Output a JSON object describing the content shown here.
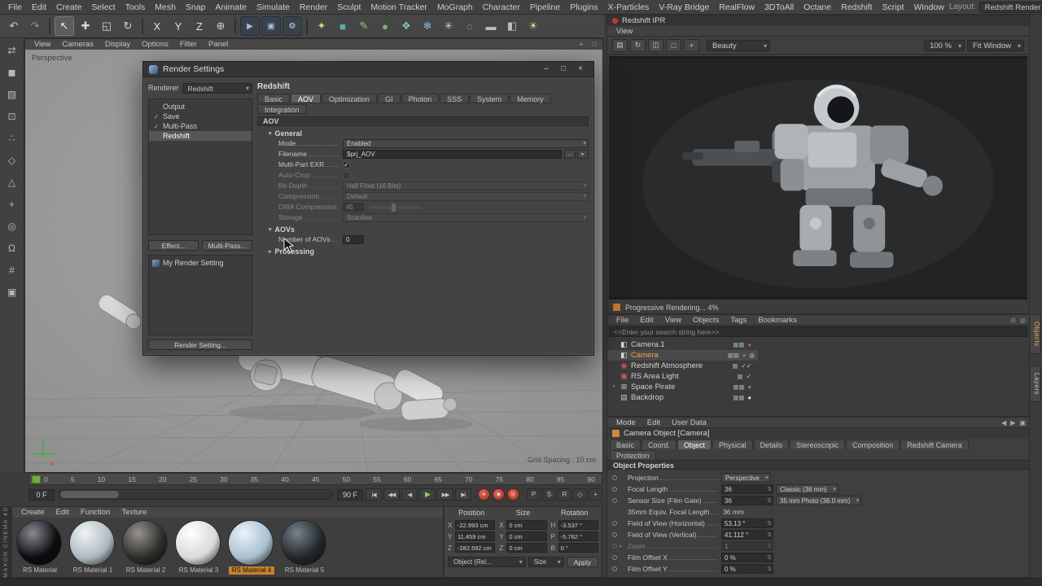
{
  "menubar": {
    "items": [
      "File",
      "Edit",
      "Create",
      "Select",
      "Tools",
      "Mesh",
      "Snap",
      "Animate",
      "Simulate",
      "Render",
      "Sculpt",
      "Motion Tracker",
      "MoGraph",
      "Character",
      "Pipeline",
      "Plugins",
      "X-Particles",
      "V-Ray Bridge",
      "RealFlow",
      "3DToAll",
      "Octane",
      "Redshift",
      "Script",
      "Window"
    ],
    "layout_label": "Layout:",
    "layout_value": "Redshift Render (User)",
    "corner_icons": [
      {
        "name": "ui-layout-icon",
        "glyph": "▦"
      },
      {
        "name": "ui-panel-icon",
        "glyph": "▤"
      }
    ]
  },
  "toolbar": {
    "icons": [
      {
        "name": "undo-icon",
        "glyph": "↶",
        "color": "#cfcfcf"
      },
      {
        "name": "redo-icon",
        "glyph": "↷",
        "color": "#909090"
      },
      {
        "name": "toolbar-separator",
        "glyph": "",
        "cls": "sep"
      },
      {
        "name": "live-selection-icon",
        "glyph": "↖",
        "color": "#f0f0f0",
        "cls": "active"
      },
      {
        "name": "move-icon",
        "glyph": "✚",
        "color": "#d8d8d8"
      },
      {
        "name": "scale-icon",
        "glyph": "◱",
        "color": "#d8d8d8"
      },
      {
        "name": "rotate-icon",
        "glyph": "↻",
        "color": "#d8d8d8"
      },
      {
        "name": "toolbar-separator",
        "glyph": "",
        "cls": "sep"
      },
      {
        "name": "lock-x-icon",
        "glyph": "X",
        "color": "#e0e0e0"
      },
      {
        "name": "lock-y-icon",
        "glyph": "Y",
        "color": "#e0e0e0"
      },
      {
        "name": "lock-z-icon",
        "glyph": "Z",
        "color": "#e0e0e0"
      },
      {
        "name": "coordinate-system-icon",
        "glyph": "⊕",
        "color": "#d0d0d0"
      },
      {
        "name": "toolbar-separator",
        "glyph": "",
        "cls": "sep"
      },
      {
        "name": "render-view-icon",
        "glyph": "▶",
        "color": "#9cc0e8",
        "cls": "slate"
      },
      {
        "name": "render-to-picture-icon",
        "glyph": "▣",
        "color": "#9cc0e8",
        "cls": "slate"
      },
      {
        "name": "render-settings-icon",
        "glyph": "⚙",
        "color": "#c8d8e8",
        "cls": "slate"
      },
      {
        "name": "toolbar-separator",
        "glyph": "",
        "cls": "sep"
      },
      {
        "name": "magic-icon",
        "glyph": "✦",
        "color": "#e2ca7a"
      },
      {
        "name": "modeling-cube-icon",
        "glyph": "■",
        "color": "#4fb3ac"
      },
      {
        "name": "spline-pen-icon",
        "glyph": "✎",
        "color": "#92c87f"
      },
      {
        "name": "primitive-sphere-icon",
        "glyph": "●",
        "color": "#74b868"
      },
      {
        "name": "mograph-cloner-icon",
        "glyph": "❖",
        "color": "#7fc8c0"
      },
      {
        "name": "simulation-icon",
        "glyph": "❄",
        "color": "#8fb8e8"
      },
      {
        "name": "xparticles-icon",
        "glyph": "✳",
        "color": "#cfcfcf"
      },
      {
        "name": "volume-icon",
        "glyph": "◌",
        "color": "#b8b8b8"
      },
      {
        "name": "floor-icon",
        "glyph": "▬",
        "color": "#bcbcbc"
      },
      {
        "name": "camera-tool-icon",
        "glyph": "◧",
        "color": "#bcbcbc"
      },
      {
        "name": "light-tool-icon",
        "glyph": "☀",
        "color": "#e8d080"
      }
    ]
  },
  "left_toolbar": {
    "icons": [
      {
        "name": "convert-icon",
        "glyph": "⇄"
      },
      {
        "name": "model-mode-icon",
        "glyph": "◼"
      },
      {
        "name": "texture-mode-icon",
        "glyph": "▨"
      },
      {
        "name": "workplane-icon",
        "glyph": "⊡"
      },
      {
        "name": "points-mode-icon",
        "glyph": "∴"
      },
      {
        "name": "edges-mode-icon",
        "glyph": "◇"
      },
      {
        "name": "polygons-mode-icon",
        "glyph": "△"
      },
      {
        "name": "enable-axis-icon",
        "glyph": "+"
      },
      {
        "name": "viewport-solo-icon",
        "glyph": "◎"
      },
      {
        "name": "snap-icon",
        "glyph": "Ω"
      },
      {
        "name": "grid-snap-icon",
        "glyph": "#"
      },
      {
        "name": "lock-icon",
        "glyph": "▣"
      }
    ]
  },
  "viewport": {
    "menu": [
      "View",
      "Cameras",
      "Display",
      "Options",
      "Filter",
      "Panel"
    ],
    "corner_icons": [
      {
        "name": "pan-view-icon",
        "glyph": "+"
      },
      {
        "name": "maximize-view-icon",
        "glyph": "□"
      }
    ],
    "camera_label": "Perspective",
    "grid_spacing_label": "Grid Spacing : 10 cm",
    "axis_label": "x"
  },
  "render_settings_dialog": {
    "title": "Render Settings",
    "window_buttons": [
      {
        "name": "minimize-button",
        "glyph": "–"
      },
      {
        "name": "maximize-button",
        "glyph": "□"
      },
      {
        "name": "close-button",
        "glyph": "×"
      }
    ],
    "renderer_label": "Renderer",
    "renderer_value": "Redshift",
    "tree": [
      {
        "name": "Output",
        "check": ""
      },
      {
        "name": "Save",
        "check": "✓"
      },
      {
        "name": "Multi-Pass",
        "check": "✓"
      },
      {
        "name": "Redshift",
        "check": "",
        "cls": "selected"
      }
    ],
    "effect_button": "Effect...",
    "multipass_button": "Multi-Pass...",
    "preset_item": "My Render Setting",
    "render_setting_button": "Render Setting...",
    "page_title": "Redshift",
    "tabs": [
      {
        "label": "Basic"
      },
      {
        "label": "AOV",
        "cls": "active"
      },
      {
        "label": "Optimization"
      },
      {
        "label": "GI"
      },
      {
        "label": "Photon"
      },
      {
        "label": "SSS"
      },
      {
        "label": "System"
      },
      {
        "label": "Memory"
      }
    ],
    "tabs_row2": [
      {
        "label": "Integration"
      }
    ],
    "section_title": "AOV",
    "groups": [
      {
        "arrow": "▾",
        "label": "General"
      },
      {
        "arrow": "▾",
        "label": "AOVs"
      },
      {
        "arrow": "▸",
        "label": "Processing"
      }
    ],
    "general_rows": [
      {
        "label": "Mode",
        "dd": "Enabled"
      },
      {
        "label": "Filename",
        "txt": "$prj_AOV",
        "cls": "file"
      },
      {
        "label": "Multi-Part EXR",
        "cls": "chk checked"
      },
      {
        "label": "Auto-Crop",
        "cls": "chk disabled"
      },
      {
        "label": "Bit-Depth",
        "dd": "Half Float (16 Bits)",
        "cls": "disabled"
      },
      {
        "label": "Compression",
        "dd": "Default",
        "cls": "disabled"
      },
      {
        "label": "DWA Compression",
        "num": "45",
        "cls": "disabled slider"
      },
      {
        "label": "Storage",
        "dd": "Scanline",
        "cls": "disabled"
      }
    ],
    "aovs_rows": [
      {
        "label": "Number of AOVs",
        "num": "0"
      }
    ]
  },
  "render_view": {
    "title": "Redshift IPR",
    "menu": [
      "View"
    ],
    "toolbar_icons": [
      {
        "name": "save-image-icon",
        "glyph": "▤"
      },
      {
        "name": "refresh-render-icon",
        "glyph": "↻"
      },
      {
        "name": "ab-compare-icon",
        "glyph": "◫"
      },
      {
        "name": "render-region-icon",
        "glyph": "□"
      },
      {
        "name": "pixel-probe-icon",
        "glyph": "+"
      }
    ],
    "channel_value": "Beauty",
    "zoom_value": "100 %",
    "fit_value": "Fit Window",
    "status": "Progressive Rendering... 4%"
  },
  "object_manager": {
    "menu": [
      "File",
      "Edit",
      "View",
      "Objects",
      "Tags",
      "Bookmarks"
    ],
    "menu_icons": [
      {
        "name": "filter-icon",
        "glyph": "⊙"
      },
      {
        "name": "search-icon",
        "glyph": "◎"
      }
    ],
    "search_value": "<<Enter your search string here>>",
    "objects": [
      {
        "pre": "",
        "icon": "◧",
        "ic": "#d8d8d8",
        "name": "Camera.1",
        "t1": "▦▦",
        "c1": "#a0a0a0",
        "t2": "●",
        "c2": "#c65a50",
        "t3": "",
        "c3": ""
      },
      {
        "pre": "",
        "icon": "◧",
        "ic": "#d8d8d8",
        "name": "Camera",
        "cls": "active",
        "t1": "▦▦",
        "c1": "#a0a0a0",
        "t2": "●",
        "c2": "#c65a50",
        "t3": "◎",
        "c3": "#e0e0e0"
      },
      {
        "pre": "",
        "icon": "◉",
        "ic": "#cf5a50",
        "name": "Redshift Atmosphere",
        "t1": "▦",
        "c1": "#a0a0a0",
        "t2": "✓✓",
        "c2": "#d0d0d0",
        "t3": "",
        "c3": ""
      },
      {
        "pre": "",
        "icon": "▣",
        "ic": "#cf5a50",
        "name": "RS Area Light",
        "t1": "▦",
        "c1": "#a0a0a0",
        "t2": "✓",
        "c2": "#d0d0d0",
        "t3": "",
        "c3": ""
      },
      {
        "pre": "+",
        "icon": "⊞",
        "ic": "#c8c8c8",
        "name": "Space Pirate",
        "t1": "▦▦",
        "c1": "#a0a0a0",
        "t2": "+",
        "c2": "#d0d0d0",
        "t3": "",
        "c3": ""
      },
      {
        "pre": "",
        "icon": "▤",
        "ic": "#c8c8c8",
        "name": "Backdrop",
        "t1": "▦▦",
        "c1": "#a0a0a0",
        "t2": "●",
        "c2": "#e8e8e8",
        "t3": "",
        "c3": ""
      }
    ]
  },
  "attribute_manager": {
    "menu": [
      "Mode",
      "Edit",
      "User Data"
    ],
    "menu_icons": [
      {
        "name": "history-back-icon",
        "glyph": "◀"
      },
      {
        "name": "history-forward-icon",
        "glyph": "▶"
      },
      {
        "name": "lock-panel-icon",
        "glyph": "▣"
      }
    ],
    "title": "Camera Object [Camera]",
    "tabs_row1": [
      {
        "label": "Basic"
      },
      {
        "label": "Coord."
      },
      {
        "label": "Object",
        "cls": "active"
      },
      {
        "label": "Physical"
      },
      {
        "label": "Details"
      },
      {
        "label": "Stereoscopic"
      },
      {
        "label": "Composition"
      },
      {
        "label": "Redshift Camera"
      }
    ],
    "tabs_row2": [
      {
        "label": "Protection"
      }
    ],
    "section_title": "Object Properties",
    "rows": [
      {
        "label": "Projection",
        "dd": "Perspective"
      },
      {
        "label": "Focal Length",
        "num": "36",
        "dd": "Classic (36 mm)"
      },
      {
        "label": "Sensor Size (Film Gate)",
        "num": "36",
        "dd": "35 mm Photo (36.0 mm)"
      },
      {
        "label": "35mm Equiv. Focal Length",
        "plain": "36 mm",
        "cls": "static"
      },
      {
        "label": "Field of View (Horizontal)",
        "num": "53.13 °"
      },
      {
        "label": "Field of View (Vertical)",
        "num": "41.112 °"
      },
      {
        "arrow": "▸",
        "label": "Zoom",
        "num": "1",
        "cls": "disabled"
      },
      {
        "label": "Film Offset X",
        "num": "0 %"
      },
      {
        "label": "Film Offset Y",
        "num": "0 %"
      }
    ]
  },
  "timeline": {
    "ticks": [
      "0",
      "5",
      "10",
      "15",
      "20",
      "25",
      "30",
      "35",
      "40",
      "45",
      "50",
      "55",
      "60",
      "65",
      "70",
      "75",
      "80",
      "85",
      "90"
    ],
    "current_frame": "0 F",
    "end_frame": "90 F",
    "transport": [
      {
        "name": "go-to-start-button",
        "glyph": "|◀"
      },
      {
        "name": "previous-key-button",
        "glyph": "◀◀"
      },
      {
        "name": "previous-frame-button",
        "glyph": "◀"
      },
      {
        "name": "play-button",
        "glyph": "▶",
        "cls": "play"
      },
      {
        "name": "next-frame-button",
        "glyph": "▶▶"
      },
      {
        "name": "go-to-end-button",
        "glyph": "▶|"
      }
    ],
    "record_buttons": [
      {
        "name": "record-keyframe-button",
        "glyph": "●"
      },
      {
        "name": "autokeying-button",
        "glyph": "◉"
      },
      {
        "name": "record-options-button",
        "glyph": "◎"
      }
    ],
    "key_toggles": [
      {
        "name": "position-key-toggle",
        "glyph": "P"
      },
      {
        "name": "scale-key-toggle",
        "glyph": "S"
      },
      {
        "name": "rotation-key-toggle",
        "glyph": "R"
      },
      {
        "name": "parameter-key-toggle",
        "glyph": "◇"
      },
      {
        "name": "point-level-key-toggle",
        "glyph": "+"
      }
    ]
  },
  "material_manager": {
    "menu": [
      "Create",
      "Edit",
      "Function",
      "Texture"
    ],
    "materials": [
      {
        "name": "RS Material",
        "c": "#0c0c0e",
        "hi": "#8a8a95"
      },
      {
        "name": "RS Material 1",
        "c": "#aeb9bf",
        "hi": "#f0f4f6"
      },
      {
        "name": "RS Material 2",
        "c": "#2d2c2a",
        "hi": "#97948e"
      },
      {
        "name": "RS Material 3",
        "c": "#d8d9da",
        "hi": "#ffffff"
      },
      {
        "name": "RS Material 4",
        "c": "#a9bfcf",
        "hi": "#eaf2f8",
        "cls": "selected"
      },
      {
        "name": "RS Material 5",
        "c": "#22272b",
        "hi": "#77828a"
      }
    ]
  },
  "coordinate_manager": {
    "position_label": "Position",
    "size_label": "Size",
    "rotation_label": "Rotation",
    "pos_rows": [
      {
        "axis": "X",
        "val": "-22.993 cm"
      },
      {
        "axis": "Y",
        "val": "11.459 cm"
      },
      {
        "axis": "Z",
        "val": "-282.592 cm"
      }
    ],
    "size_rows": [
      {
        "axis": "X",
        "val": "0 cm"
      },
      {
        "axis": "Y",
        "val": "0 cm"
      },
      {
        "axis": "Z",
        "val": "0 cm"
      }
    ],
    "rot_rows": [
      {
        "axis": "H",
        "val": "-3.537 °"
      },
      {
        "axis": "P",
        "val": "-5.762 °"
      },
      {
        "axis": "B",
        "val": "0 °"
      }
    ],
    "object_mode_value": "Object (Rel...",
    "size_mode_value": "Size",
    "apply_button": "Apply"
  },
  "right_strip": {
    "tabs": [
      {
        "label": "Objects",
        "cls": "active"
      },
      {
        "label": "Layers"
      }
    ]
  },
  "branding": {
    "vertical_text": "MAXON CINEMA 4D"
  }
}
